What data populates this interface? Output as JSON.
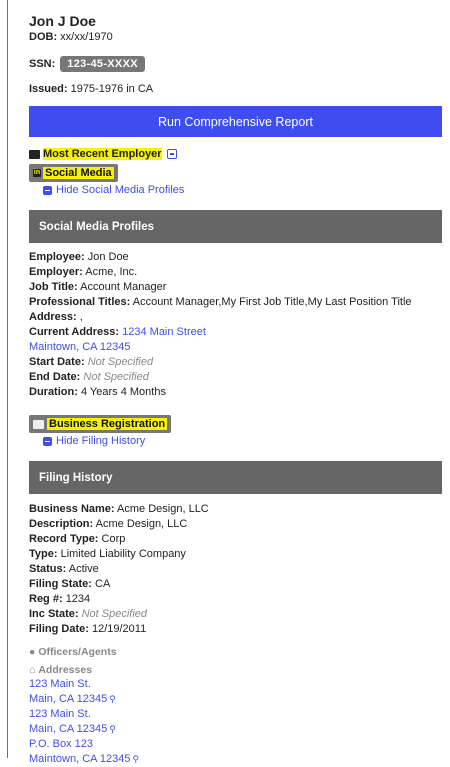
{
  "person": {
    "name": "Jon J Doe",
    "dob_label": "DOB:",
    "dob": "xx/xx/1970",
    "ssn_label": "SSN:",
    "ssn": "123-45-XXXX",
    "issued_label": "Issued:",
    "issued": "1975-1976 in CA"
  },
  "run_report_label": "Run Comprehensive Report",
  "most_recent_employer_label": "Most Recent Employer",
  "social_media": {
    "pill_label": "Social Media",
    "toggle_label": "Hide Social Media Profiles",
    "panel_title": "Social Media Profiles",
    "fields": {
      "employee_label": "Employee:",
      "employee": "Jon Doe",
      "employer_label": "Employer:",
      "employer": "Acme, Inc.",
      "job_title_label": "Job Title:",
      "job_title": "Account Manager",
      "prof_titles_label": "Professional Titles:",
      "prof_titles": "Account Manager,My First Job Title,My Last Position Title",
      "address_label": "Address:",
      "address": ",",
      "current_address_label": "Current Address:",
      "current_address_line1": "1234 Main Street",
      "current_address_line2": "Maintown, CA 12345",
      "start_date_label": "Start Date:",
      "start_date": "Not Specified",
      "end_date_label": "End Date:",
      "end_date": "Not Specified",
      "duration_label": "Duration:",
      "duration": "4 Years 4 Months"
    }
  },
  "business": {
    "pill_label": "Business Registration",
    "toggle_label": "Hide Filing History",
    "panel_title": "Filing History",
    "fields": {
      "business_name_label": "Business Name:",
      "business_name": "Acme Design, LLC",
      "description_label": "Description:",
      "description": "Acme Design, LLC",
      "record_type_label": "Record Type:",
      "record_type": "Corp",
      "type_label": "Type:",
      "type": "Limited Liability Company",
      "status_label": "Status:",
      "status": "Active",
      "filing_state_label": "Filing State:",
      "filing_state": "CA",
      "reg_label": "Reg #:",
      "reg": "1234",
      "inc_state_label": "Inc State:",
      "inc_state": "Not Specified",
      "filing_date_label": "Filing Date:",
      "filing_date": "12/19/2011"
    },
    "officers_label": "Officers/Agents",
    "addresses_label": "Addresses",
    "addresses": [
      {
        "line1": "123 Main St.",
        "line2": "Main, CA 12345"
      },
      {
        "line1": "123 Main St.",
        "line2": "Main, CA 12345"
      },
      {
        "line1": "P.O. Box 123",
        "line2": "Maintown, CA 12345"
      }
    ]
  },
  "colors": {
    "accent": "#3f4cf0",
    "highlight": "#f6f200",
    "panel": "#666666",
    "badge": "#777777"
  }
}
